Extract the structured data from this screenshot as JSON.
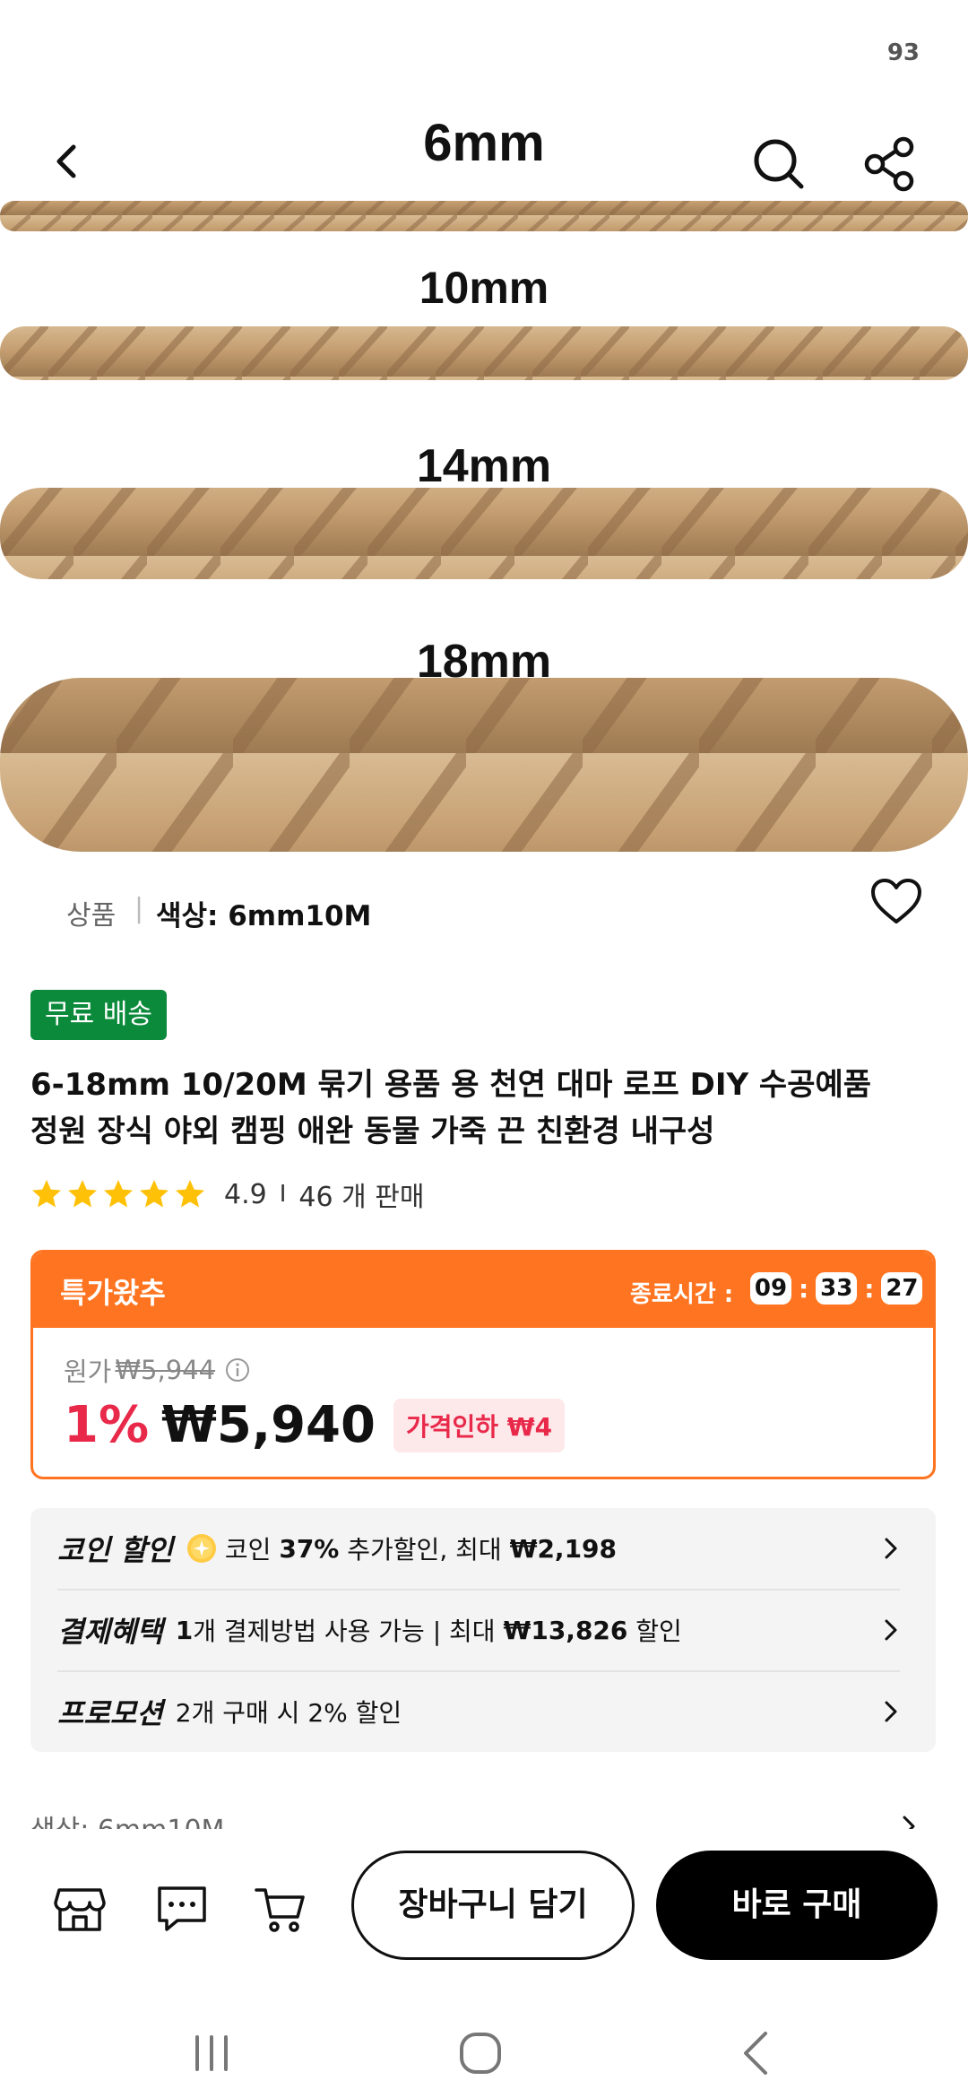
{
  "status_bar": {
    "battery": "93"
  },
  "product_image": {
    "rope_labels": [
      "6mm",
      "10mm",
      "14mm",
      "18mm"
    ],
    "rope_color": "#c9a57c"
  },
  "options": {
    "crumb": "상품",
    "selected": "색상: 6mm10M"
  },
  "badge": {
    "free_shipping": "무료 배송"
  },
  "title": {
    "line1": "6-18mm 10/20M 묶기 용품 용 천연 대마 로프 DIY 수공예품",
    "line2": "정원 장식 야외 캠핑 애완 동물 가죽 끈 친환경 내구성"
  },
  "rating": {
    "value": "4.9",
    "separator": "I",
    "sold": "46 개 판매",
    "stars": 5
  },
  "deal": {
    "label": "특가왔추",
    "ends_label": "종료시간 :",
    "timer": {
      "hours": "09",
      "minutes": "33",
      "seconds": "27"
    },
    "orig_label": "원가",
    "orig_price": "₩5,944",
    "discount": "1%",
    "price": "₩5,940",
    "price_drop": "가격인하 ₩4",
    "accent": "#ff7420",
    "discount_color": "#e8294a"
  },
  "benefits": {
    "coin": {
      "label": "코인 할인",
      "pre": "코인",
      "pct": "37%",
      "mid": "추가할인, 최대",
      "max": "₩2,198"
    },
    "payment": {
      "label": "결제혜택",
      "count": "1",
      "mid": "개 결제방법 사용 가능 | 최대",
      "max": "₩13,826",
      "post": "할인"
    },
    "promo": {
      "label": "프로모션",
      "text": "2개 구매 시 2% 할인"
    }
  },
  "color_row": {
    "text": "색상: 6mm10M"
  },
  "actions": {
    "add_to_cart": "장바구니 담기",
    "buy_now": "바로 구매"
  }
}
